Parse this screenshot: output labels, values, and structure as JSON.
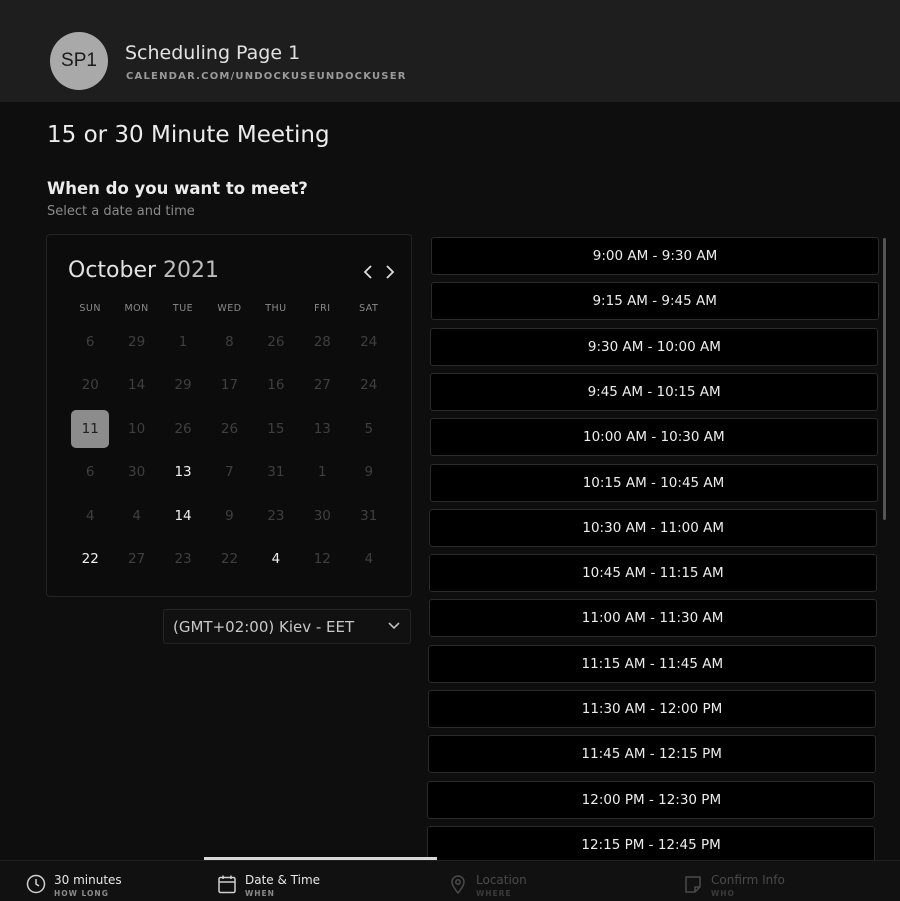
{
  "header": {
    "avatar_initials": "SP1",
    "page_name": "Scheduling Page 1",
    "page_url": "CALENDAR.COM/UNDOCKUSEUNDOCKUSER"
  },
  "meeting": {
    "title": "15 or 30 Minute Meeting",
    "question": "When do you want to meet?",
    "subtitle": "Select a date and time"
  },
  "calendar": {
    "month": "October",
    "year": "2021",
    "prev_icon": "chevron-left-icon",
    "next_icon": "chevron-right-icon",
    "weekdays": [
      "SUN",
      "MON",
      "TUE",
      "WED",
      "THU",
      "FRI",
      "SAT"
    ],
    "weeks": [
      [
        {
          "d": "6",
          "s": "dim"
        },
        {
          "d": "29",
          "s": "dim"
        },
        {
          "d": "1",
          "s": "dim"
        },
        {
          "d": "8",
          "s": "dim"
        },
        {
          "d": "26",
          "s": "dim"
        },
        {
          "d": "28",
          "s": "dim"
        },
        {
          "d": "24",
          "s": "dim"
        }
      ],
      [
        {
          "d": "20",
          "s": "dim"
        },
        {
          "d": "14",
          "s": "dim"
        },
        {
          "d": "29",
          "s": "dim"
        },
        {
          "d": "17",
          "s": "dim"
        },
        {
          "d": "16",
          "s": "dim"
        },
        {
          "d": "27",
          "s": "dim"
        },
        {
          "d": "24",
          "s": "dim"
        }
      ],
      [
        {
          "d": "11",
          "s": "selected"
        },
        {
          "d": "10",
          "s": "dim"
        },
        {
          "d": "26",
          "s": "dim"
        },
        {
          "d": "26",
          "s": "dim"
        },
        {
          "d": "15",
          "s": "dim"
        },
        {
          "d": "13",
          "s": "dim"
        },
        {
          "d": "5",
          "s": "dim"
        }
      ],
      [
        {
          "d": "6",
          "s": "dim"
        },
        {
          "d": "30",
          "s": "dim"
        },
        {
          "d": "13",
          "s": "available"
        },
        {
          "d": "7",
          "s": "dim"
        },
        {
          "d": "31",
          "s": "dim"
        },
        {
          "d": "1",
          "s": "dim"
        },
        {
          "d": "9",
          "s": "dim"
        }
      ],
      [
        {
          "d": "4",
          "s": "dim"
        },
        {
          "d": "4",
          "s": "dim"
        },
        {
          "d": "14",
          "s": "available"
        },
        {
          "d": "9",
          "s": "dim"
        },
        {
          "d": "23",
          "s": "dim"
        },
        {
          "d": "30",
          "s": "dim"
        },
        {
          "d": "31",
          "s": "dim"
        }
      ],
      [
        {
          "d": "22",
          "s": "available"
        },
        {
          "d": "27",
          "s": "dim"
        },
        {
          "d": "23",
          "s": "dim"
        },
        {
          "d": "22",
          "s": "dim"
        },
        {
          "d": "4",
          "s": "available"
        },
        {
          "d": "12",
          "s": "dim"
        },
        {
          "d": "4",
          "s": "dim"
        }
      ]
    ]
  },
  "timezone": {
    "value": "(GMT+02:00) Kiev - EET",
    "icon": "chevron-down-icon"
  },
  "slots": [
    "9:00 AM - 9:30 AM",
    "9:15 AM - 9:45 AM",
    "9:30 AM - 10:00 AM",
    "9:45 AM - 10:15 AM",
    "10:00 AM - 10:30 AM",
    "10:15 AM - 10:45 AM",
    "10:30 AM - 11:00 AM",
    "10:45 AM - 11:15 AM",
    "11:00 AM - 11:30 AM",
    "11:15 AM - 11:45 AM",
    "11:30 AM - 12:00 PM",
    "11:45 AM - 12:15 PM",
    "12:00 PM - 12:30 PM",
    "12:15 PM - 12:45 PM"
  ],
  "steps": [
    {
      "label": "30 minutes",
      "sub": "HOW LONG",
      "icon": "clock-icon",
      "active": true
    },
    {
      "label": "Date & Time",
      "sub": "WHEN",
      "icon": "calendar-icon",
      "active": true
    },
    {
      "label": "Location",
      "sub": "WHERE",
      "icon": "map-pin-icon",
      "active": false
    },
    {
      "label": "Confirm Info",
      "sub": "WHO",
      "icon": "note-icon",
      "active": false
    }
  ],
  "colors": {
    "background": "#0e0e0e",
    "header": "#1e1e1e",
    "selected_day": "#8c8c8c",
    "progress": "#d8d8d8"
  }
}
